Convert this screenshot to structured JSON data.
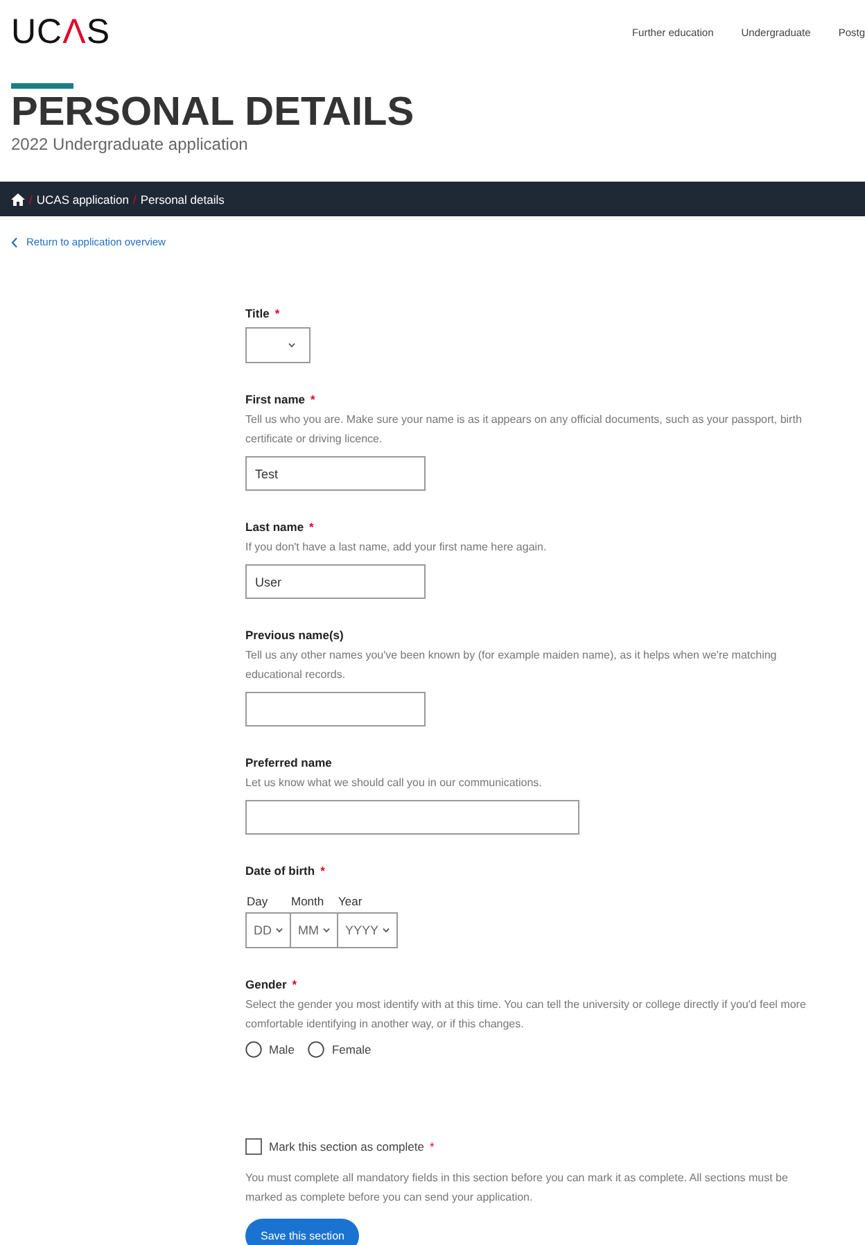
{
  "header": {
    "logo": [
      {
        "text": "UC",
        "accent": false
      },
      {
        "text": "Λ",
        "accent": true
      },
      {
        "text": "S",
        "accent": false
      }
    ],
    "nav": [
      "Further education",
      "Undergraduate",
      "Postg"
    ]
  },
  "page": {
    "title": "PERSONAL DETAILS",
    "subtitle": "2022 Undergraduate application"
  },
  "breadcrumb": [
    {
      "label": "UCAS application",
      "separator": "/"
    },
    {
      "label": "Personal details",
      "separator": "/"
    }
  ],
  "back_link": "Return to application overview",
  "fields": [
    {
      "kind": "select",
      "label": "Title",
      "marker": "*"
    },
    {
      "kind": "text",
      "label": "First name",
      "marker": "*",
      "hint": "Tell us who you are. Make sure your name is as it appears on any official documents, such as your passport, birth certificate or driving licence.",
      "value": "Test"
    },
    {
      "kind": "text",
      "label": "Last name",
      "marker": "*",
      "hint": "If you don't have a last name, add your first name here again.",
      "value": "User"
    },
    {
      "kind": "text",
      "label": "Previous name(s)",
      "hint": "Tell us any other names you've been known by (for example maiden name), as it helps when we're matching educational records."
    },
    {
      "kind": "wide_text",
      "label": "Preferred name",
      "hint": "Let us know what we should call you in our communications."
    },
    {
      "kind": "date",
      "label": "Date of birth",
      "marker": "*",
      "parts": [
        {
          "label": "Day",
          "placeholder": "DD"
        },
        {
          "label": "Month",
          "placeholder": "MM"
        },
        {
          "label": "Year",
          "placeholder": "YYYY"
        }
      ]
    },
    {
      "kind": "radio",
      "label": "Gender",
      "marker": "*",
      "hint": "Select the gender you most identify with at this time. You can tell the university or college directly if you'd feel more comfortable identifying in another way, or if this changes.",
      "options": [
        {
          "label": "Male",
          "selected": false
        },
        {
          "label": "Female",
          "selected": false
        }
      ]
    }
  ],
  "complete": {
    "label": "Mark this section as complete",
    "marker": "*",
    "checked": false,
    "note": "You must complete all mandatory fields in this section before you can mark it as complete. All sections must be marked as complete before you can send your application."
  },
  "save_button": "Save this section"
}
